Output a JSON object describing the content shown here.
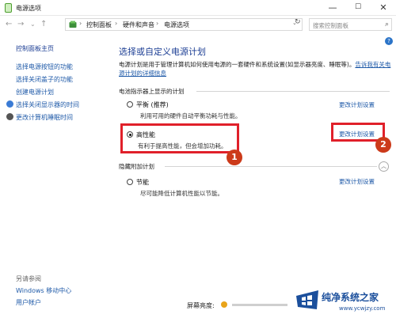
{
  "window": {
    "title": "电源选项",
    "minimize": "—",
    "maximize": "☐",
    "close": "✕"
  },
  "nav": {
    "breadcrumbs": [
      "控制面板",
      "硬件和声音",
      "电源选项"
    ],
    "breadcrumb_separator": "›",
    "search_placeholder": "搜索控制面板"
  },
  "sidebar": {
    "items": [
      {
        "label": "控制面板主页"
      },
      {
        "label": "选择电源按钮的功能"
      },
      {
        "label": "选择关闭盖子的功能"
      },
      {
        "label": "创建电源计划"
      },
      {
        "label": "选择关闭显示器的时间"
      },
      {
        "label": "更改计算机睡眠时间"
      }
    ],
    "see_also_heading": "另请参阅",
    "see_also": [
      {
        "label": "Windows 移动中心"
      },
      {
        "label": "用户帐户"
      }
    ]
  },
  "main": {
    "title": "选择或自定义电源计划",
    "description": "电源计划是用于管理计算机如何使用电源的一套硬件和系统设置(如显示器亮度、睡眠等)。",
    "description_link": "告诉我有关电源计划的详细信息",
    "battery_section_label": "电池指示器上显示的计划",
    "hidden_section_label": "隐藏附加计划",
    "change_link": "更改计划设置",
    "plans": [
      {
        "name": "平衡 (推荐)",
        "desc": "利用可用的硬件自动平衡功耗与性能。",
        "selected": false
      },
      {
        "name": "高性能",
        "desc": "有利于提高性能，但会增加功耗。",
        "selected": true
      },
      {
        "name": "节能",
        "desc": "尽可能降低计算机性能以节能。",
        "selected": false
      }
    ]
  },
  "annotations": {
    "badge1": "1",
    "badge2": "2",
    "box_color": "#e0202a"
  },
  "footer": {
    "brightness_label": "屏幕亮度:"
  },
  "watermark": {
    "title": "纯净系统之家",
    "url": "www.ycwjzy.com"
  }
}
